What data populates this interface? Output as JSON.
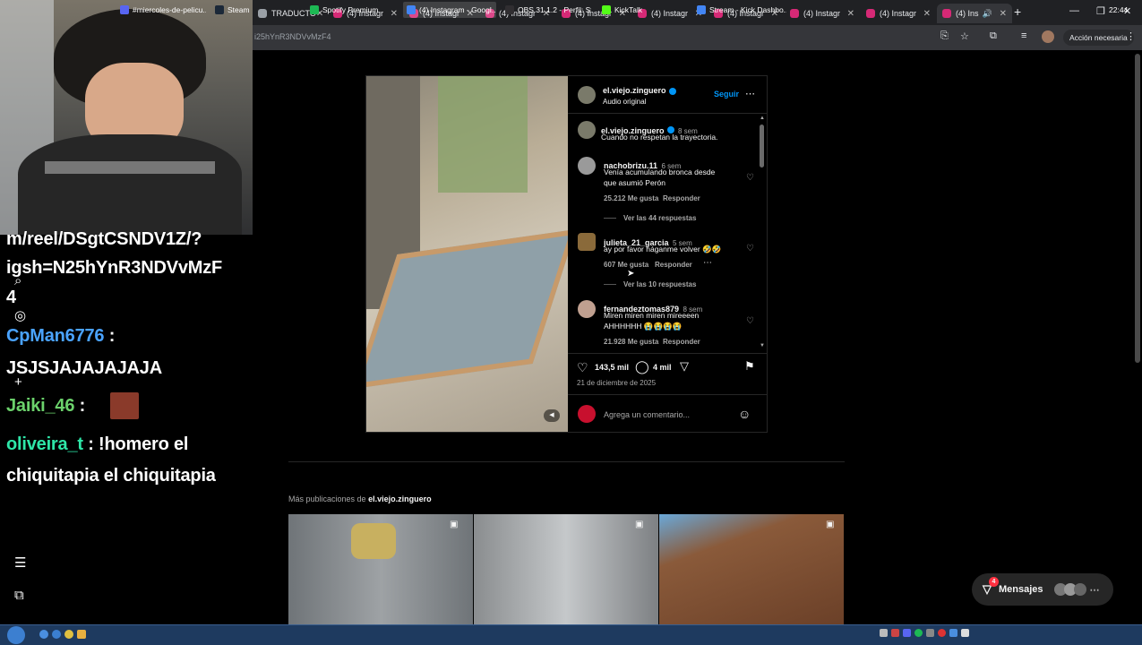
{
  "browser": {
    "tabs": [
      {
        "label": "TRADUCTO",
        "color": "#9aa0a6"
      },
      {
        "label": "(4) Instagr",
        "color": "#d62976"
      },
      {
        "label": "(4) Instagr",
        "color": "#d62976"
      },
      {
        "label": "(4) Instagr",
        "color": "#d62976"
      },
      {
        "label": "(4) Instagr",
        "color": "#d62976"
      },
      {
        "label": "(4) Instagr",
        "color": "#d62976"
      },
      {
        "label": "(4) Instagr",
        "color": "#d62976"
      },
      {
        "label": "(4) Instagr",
        "color": "#d62976"
      },
      {
        "label": "(4) Instagr",
        "color": "#d62976"
      },
      {
        "label": "(4) Ins",
        "color": "#d62976"
      }
    ],
    "url": "i25hYnR3NDVvMzF4",
    "action_button": "Acción necesaria"
  },
  "chat": {
    "lines": [
      {
        "user": "",
        "text": "m/reel/DSgtCSNDV1Z/?",
        "color": "#ffffff"
      },
      {
        "user": "",
        "text": "igsh=N25hYnR3NDVvMzF",
        "color": "#ffffff"
      },
      {
        "user": "",
        "text": "4",
        "color": "#ffffff"
      },
      {
        "user": "CpMan6776",
        "text": ":",
        "color": "#4aa3ff"
      },
      {
        "user": "",
        "text": "JSJSJAJAJAJAJA",
        "color": "#ffffff"
      },
      {
        "user": "Jaiki_46",
        "text": ":",
        "color": "#6bd16b"
      },
      {
        "user": "oliveira_t",
        "text": ": !homero el",
        "color": "#2ee6a8"
      },
      {
        "user": "",
        "text": "chiquitapia el chiquitapia",
        "color": "#ffffff"
      }
    ]
  },
  "post": {
    "author": "el.viejo.zinguero",
    "audio": "Audio original",
    "follow": "Seguir",
    "caption_user": "el.viejo.zinguero",
    "caption_time": "8 sem",
    "caption": "Cuando no respetan la trayectoria.",
    "comments": [
      {
        "user": "nachobrizu.11",
        "time": "6 sem",
        "text1": "Venía acumulando bronca desde",
        "text2": "que asumió Perón",
        "likes": "25.212 Me gusta",
        "reply": "Responder",
        "more": "Ver las 44 respuestas"
      },
      {
        "user": "julieta_21_garcia",
        "time": "5 sem",
        "text1": "ay por favor háganme volver 🤣🤣",
        "text2": "",
        "likes": "607 Me gusta",
        "reply": "Responder",
        "more": "Ver las 10 respuestas"
      },
      {
        "user": "fernandeztomas879",
        "time": "8 sem",
        "text1": "Miren miren miren mireeeen",
        "text2": "AHHHHHH 😭😭😭😭",
        "likes": "21.928 Me gusta",
        "reply": "Responder",
        "more": ""
      }
    ],
    "like_count": "143,5 mil",
    "comment_count": "4 mil",
    "date": "21 de diciembre de 2025",
    "comment_placeholder": "Agrega un comentario..."
  },
  "more_posts": {
    "label": "Más publicaciones de",
    "user": "el.viejo.zinguero"
  },
  "messages": {
    "label": "Mensajes",
    "badge": "4"
  },
  "taskbar": {
    "items": [
      {
        "label": "#miercoles-de-pelicu...",
        "color": "#5865f2"
      },
      {
        "label": "Steam",
        "color": "#1b2838"
      },
      {
        "label": "Spotify Premium",
        "color": "#1db954"
      },
      {
        "label": "(4) Instagram - Googl...",
        "color": "#4285f4"
      },
      {
        "label": "OBS 31.1.2 - Perfil: St...",
        "color": "#302e31"
      },
      {
        "label": "KickTalk",
        "color": "#53fc18"
      },
      {
        "label": "Stream - Kick Dashbo...",
        "color": "#4285f4"
      }
    ],
    "clock": "22:44"
  }
}
